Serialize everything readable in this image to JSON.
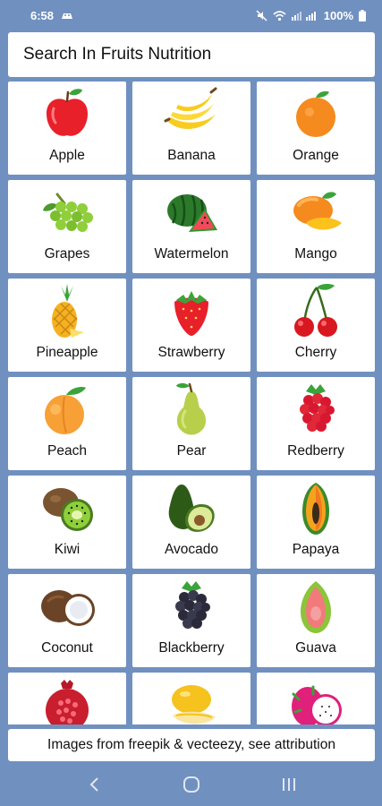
{
  "status": {
    "time": "6:58",
    "battery": "100%"
  },
  "search": {
    "placeholder": "Search In Fruits Nutrition"
  },
  "fruits": [
    {
      "label": "Apple",
      "icon": "apple-icon"
    },
    {
      "label": "Banana",
      "icon": "banana-icon"
    },
    {
      "label": "Orange",
      "icon": "orange-icon"
    },
    {
      "label": "Grapes",
      "icon": "grapes-icon"
    },
    {
      "label": "Watermelon",
      "icon": "watermelon-icon"
    },
    {
      "label": "Mango",
      "icon": "mango-icon"
    },
    {
      "label": "Pineapple",
      "icon": "pineapple-icon"
    },
    {
      "label": "Strawberry",
      "icon": "strawberry-icon"
    },
    {
      "label": "Cherry",
      "icon": "cherry-icon"
    },
    {
      "label": "Peach",
      "icon": "peach-icon"
    },
    {
      "label": "Pear",
      "icon": "pear-icon"
    },
    {
      "label": "Redberry",
      "icon": "redberry-icon"
    },
    {
      "label": "Kiwi",
      "icon": "kiwi-icon"
    },
    {
      "label": "Avocado",
      "icon": "avocado-icon"
    },
    {
      "label": "Papaya",
      "icon": "papaya-icon"
    },
    {
      "label": "Coconut",
      "icon": "coconut-icon"
    },
    {
      "label": "Blackberry",
      "icon": "blackberry-icon"
    },
    {
      "label": "Guava",
      "icon": "guava-icon"
    },
    {
      "label": "",
      "icon": "pomegranate-icon"
    },
    {
      "label": "",
      "icon": "melon-icon"
    },
    {
      "label": "",
      "icon": "dragonfruit-icon"
    }
  ],
  "footer": {
    "attribution": "Images from freepik & vecteezy, see attribution"
  },
  "colors": {
    "background": "#7090c0",
    "card": "#ffffff"
  }
}
